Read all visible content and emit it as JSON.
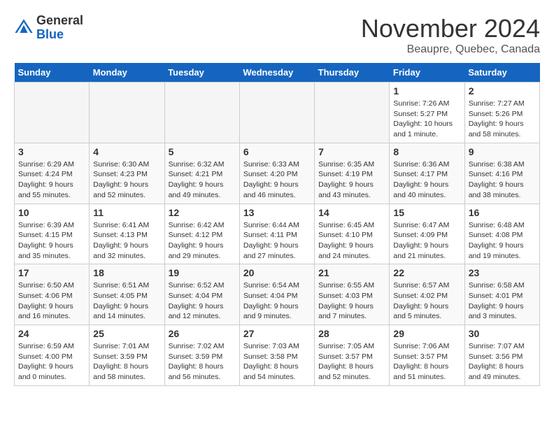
{
  "header": {
    "logo_general": "General",
    "logo_blue": "Blue",
    "month_title": "November 2024",
    "location": "Beaupre, Quebec, Canada"
  },
  "weekdays": [
    "Sunday",
    "Monday",
    "Tuesday",
    "Wednesday",
    "Thursday",
    "Friday",
    "Saturday"
  ],
  "weeks": [
    [
      {
        "day": "",
        "info": ""
      },
      {
        "day": "",
        "info": ""
      },
      {
        "day": "",
        "info": ""
      },
      {
        "day": "",
        "info": ""
      },
      {
        "day": "",
        "info": ""
      },
      {
        "day": "1",
        "info": "Sunrise: 7:26 AM\nSunset: 5:27 PM\nDaylight: 10 hours and 1 minute."
      },
      {
        "day": "2",
        "info": "Sunrise: 7:27 AM\nSunset: 5:26 PM\nDaylight: 9 hours and 58 minutes."
      }
    ],
    [
      {
        "day": "3",
        "info": "Sunrise: 6:29 AM\nSunset: 4:24 PM\nDaylight: 9 hours and 55 minutes."
      },
      {
        "day": "4",
        "info": "Sunrise: 6:30 AM\nSunset: 4:23 PM\nDaylight: 9 hours and 52 minutes."
      },
      {
        "day": "5",
        "info": "Sunrise: 6:32 AM\nSunset: 4:21 PM\nDaylight: 9 hours and 49 minutes."
      },
      {
        "day": "6",
        "info": "Sunrise: 6:33 AM\nSunset: 4:20 PM\nDaylight: 9 hours and 46 minutes."
      },
      {
        "day": "7",
        "info": "Sunrise: 6:35 AM\nSunset: 4:19 PM\nDaylight: 9 hours and 43 minutes."
      },
      {
        "day": "8",
        "info": "Sunrise: 6:36 AM\nSunset: 4:17 PM\nDaylight: 9 hours and 40 minutes."
      },
      {
        "day": "9",
        "info": "Sunrise: 6:38 AM\nSunset: 4:16 PM\nDaylight: 9 hours and 38 minutes."
      }
    ],
    [
      {
        "day": "10",
        "info": "Sunrise: 6:39 AM\nSunset: 4:15 PM\nDaylight: 9 hours and 35 minutes."
      },
      {
        "day": "11",
        "info": "Sunrise: 6:41 AM\nSunset: 4:13 PM\nDaylight: 9 hours and 32 minutes."
      },
      {
        "day": "12",
        "info": "Sunrise: 6:42 AM\nSunset: 4:12 PM\nDaylight: 9 hours and 29 minutes."
      },
      {
        "day": "13",
        "info": "Sunrise: 6:44 AM\nSunset: 4:11 PM\nDaylight: 9 hours and 27 minutes."
      },
      {
        "day": "14",
        "info": "Sunrise: 6:45 AM\nSunset: 4:10 PM\nDaylight: 9 hours and 24 minutes."
      },
      {
        "day": "15",
        "info": "Sunrise: 6:47 AM\nSunset: 4:09 PM\nDaylight: 9 hours and 21 minutes."
      },
      {
        "day": "16",
        "info": "Sunrise: 6:48 AM\nSunset: 4:08 PM\nDaylight: 9 hours and 19 minutes."
      }
    ],
    [
      {
        "day": "17",
        "info": "Sunrise: 6:50 AM\nSunset: 4:06 PM\nDaylight: 9 hours and 16 minutes."
      },
      {
        "day": "18",
        "info": "Sunrise: 6:51 AM\nSunset: 4:05 PM\nDaylight: 9 hours and 14 minutes."
      },
      {
        "day": "19",
        "info": "Sunrise: 6:52 AM\nSunset: 4:04 PM\nDaylight: 9 hours and 12 minutes."
      },
      {
        "day": "20",
        "info": "Sunrise: 6:54 AM\nSunset: 4:04 PM\nDaylight: 9 hours and 9 minutes."
      },
      {
        "day": "21",
        "info": "Sunrise: 6:55 AM\nSunset: 4:03 PM\nDaylight: 9 hours and 7 minutes."
      },
      {
        "day": "22",
        "info": "Sunrise: 6:57 AM\nSunset: 4:02 PM\nDaylight: 9 hours and 5 minutes."
      },
      {
        "day": "23",
        "info": "Sunrise: 6:58 AM\nSunset: 4:01 PM\nDaylight: 9 hours and 3 minutes."
      }
    ],
    [
      {
        "day": "24",
        "info": "Sunrise: 6:59 AM\nSunset: 4:00 PM\nDaylight: 9 hours and 0 minutes."
      },
      {
        "day": "25",
        "info": "Sunrise: 7:01 AM\nSunset: 3:59 PM\nDaylight: 8 hours and 58 minutes."
      },
      {
        "day": "26",
        "info": "Sunrise: 7:02 AM\nSunset: 3:59 PM\nDaylight: 8 hours and 56 minutes."
      },
      {
        "day": "27",
        "info": "Sunrise: 7:03 AM\nSunset: 3:58 PM\nDaylight: 8 hours and 54 minutes."
      },
      {
        "day": "28",
        "info": "Sunrise: 7:05 AM\nSunset: 3:57 PM\nDaylight: 8 hours and 52 minutes."
      },
      {
        "day": "29",
        "info": "Sunrise: 7:06 AM\nSunset: 3:57 PM\nDaylight: 8 hours and 51 minutes."
      },
      {
        "day": "30",
        "info": "Sunrise: 7:07 AM\nSunset: 3:56 PM\nDaylight: 8 hours and 49 minutes."
      }
    ]
  ]
}
